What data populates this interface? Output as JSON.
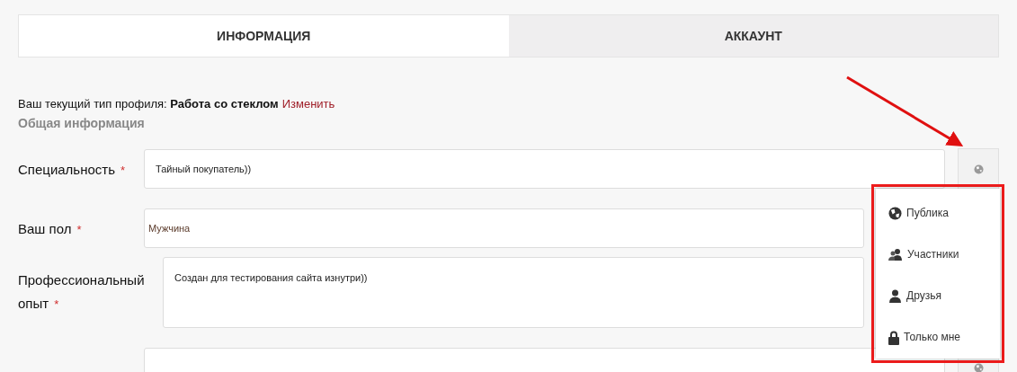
{
  "tabs": [
    {
      "label": "ИНФОРМАЦИЯ",
      "selected": true
    },
    {
      "label": "АККАУНТ",
      "selected": false
    }
  ],
  "profile_type": {
    "prefix": "Ваш текущий тип профиля:",
    "value": "Работа со стеклом",
    "change_link": "Изменить"
  },
  "section_title": "Общая информация",
  "fields": [
    {
      "kind": "input",
      "label": "Специальность",
      "required_mark": "*",
      "value": "Тайный покупатель))"
    },
    {
      "kind": "input",
      "label": "Ваш пол",
      "required_mark": "*",
      "value": "Мужчина"
    },
    {
      "kind": "textarea",
      "label": "Профессиональный опыт",
      "required_mark": "*",
      "value": "Создан для тестирования сайта изнутри))"
    },
    {
      "kind": "input"
    }
  ],
  "privacy_menu": {
    "items": [
      {
        "kind": "globe",
        "label": "Публика"
      },
      {
        "kind": "group",
        "label": "Участники"
      },
      {
        "kind": "person",
        "label": "Друзья"
      },
      {
        "kind": "lock",
        "label": "Только мне"
      }
    ]
  }
}
